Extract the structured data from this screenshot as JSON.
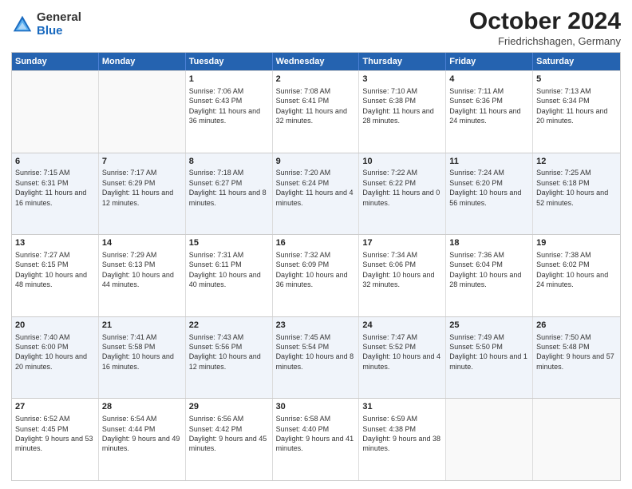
{
  "logo": {
    "general": "General",
    "blue": "Blue"
  },
  "title": "October 2024",
  "subtitle": "Friedrichshagen, Germany",
  "days": [
    "Sunday",
    "Monday",
    "Tuesday",
    "Wednesday",
    "Thursday",
    "Friday",
    "Saturday"
  ],
  "weeks": [
    [
      {
        "day": "",
        "sunrise": "",
        "sunset": "",
        "daylight": ""
      },
      {
        "day": "",
        "sunrise": "",
        "sunset": "",
        "daylight": ""
      },
      {
        "day": "1",
        "sunrise": "Sunrise: 7:06 AM",
        "sunset": "Sunset: 6:43 PM",
        "daylight": "Daylight: 11 hours and 36 minutes."
      },
      {
        "day": "2",
        "sunrise": "Sunrise: 7:08 AM",
        "sunset": "Sunset: 6:41 PM",
        "daylight": "Daylight: 11 hours and 32 minutes."
      },
      {
        "day": "3",
        "sunrise": "Sunrise: 7:10 AM",
        "sunset": "Sunset: 6:38 PM",
        "daylight": "Daylight: 11 hours and 28 minutes."
      },
      {
        "day": "4",
        "sunrise": "Sunrise: 7:11 AM",
        "sunset": "Sunset: 6:36 PM",
        "daylight": "Daylight: 11 hours and 24 minutes."
      },
      {
        "day": "5",
        "sunrise": "Sunrise: 7:13 AM",
        "sunset": "Sunset: 6:34 PM",
        "daylight": "Daylight: 11 hours and 20 minutes."
      }
    ],
    [
      {
        "day": "6",
        "sunrise": "Sunrise: 7:15 AM",
        "sunset": "Sunset: 6:31 PM",
        "daylight": "Daylight: 11 hours and 16 minutes."
      },
      {
        "day": "7",
        "sunrise": "Sunrise: 7:17 AM",
        "sunset": "Sunset: 6:29 PM",
        "daylight": "Daylight: 11 hours and 12 minutes."
      },
      {
        "day": "8",
        "sunrise": "Sunrise: 7:18 AM",
        "sunset": "Sunset: 6:27 PM",
        "daylight": "Daylight: 11 hours and 8 minutes."
      },
      {
        "day": "9",
        "sunrise": "Sunrise: 7:20 AM",
        "sunset": "Sunset: 6:24 PM",
        "daylight": "Daylight: 11 hours and 4 minutes."
      },
      {
        "day": "10",
        "sunrise": "Sunrise: 7:22 AM",
        "sunset": "Sunset: 6:22 PM",
        "daylight": "Daylight: 11 hours and 0 minutes."
      },
      {
        "day": "11",
        "sunrise": "Sunrise: 7:24 AM",
        "sunset": "Sunset: 6:20 PM",
        "daylight": "Daylight: 10 hours and 56 minutes."
      },
      {
        "day": "12",
        "sunrise": "Sunrise: 7:25 AM",
        "sunset": "Sunset: 6:18 PM",
        "daylight": "Daylight: 10 hours and 52 minutes."
      }
    ],
    [
      {
        "day": "13",
        "sunrise": "Sunrise: 7:27 AM",
        "sunset": "Sunset: 6:15 PM",
        "daylight": "Daylight: 10 hours and 48 minutes."
      },
      {
        "day": "14",
        "sunrise": "Sunrise: 7:29 AM",
        "sunset": "Sunset: 6:13 PM",
        "daylight": "Daylight: 10 hours and 44 minutes."
      },
      {
        "day": "15",
        "sunrise": "Sunrise: 7:31 AM",
        "sunset": "Sunset: 6:11 PM",
        "daylight": "Daylight: 10 hours and 40 minutes."
      },
      {
        "day": "16",
        "sunrise": "Sunrise: 7:32 AM",
        "sunset": "Sunset: 6:09 PM",
        "daylight": "Daylight: 10 hours and 36 minutes."
      },
      {
        "day": "17",
        "sunrise": "Sunrise: 7:34 AM",
        "sunset": "Sunset: 6:06 PM",
        "daylight": "Daylight: 10 hours and 32 minutes."
      },
      {
        "day": "18",
        "sunrise": "Sunrise: 7:36 AM",
        "sunset": "Sunset: 6:04 PM",
        "daylight": "Daylight: 10 hours and 28 minutes."
      },
      {
        "day": "19",
        "sunrise": "Sunrise: 7:38 AM",
        "sunset": "Sunset: 6:02 PM",
        "daylight": "Daylight: 10 hours and 24 minutes."
      }
    ],
    [
      {
        "day": "20",
        "sunrise": "Sunrise: 7:40 AM",
        "sunset": "Sunset: 6:00 PM",
        "daylight": "Daylight: 10 hours and 20 minutes."
      },
      {
        "day": "21",
        "sunrise": "Sunrise: 7:41 AM",
        "sunset": "Sunset: 5:58 PM",
        "daylight": "Daylight: 10 hours and 16 minutes."
      },
      {
        "day": "22",
        "sunrise": "Sunrise: 7:43 AM",
        "sunset": "Sunset: 5:56 PM",
        "daylight": "Daylight: 10 hours and 12 minutes."
      },
      {
        "day": "23",
        "sunrise": "Sunrise: 7:45 AM",
        "sunset": "Sunset: 5:54 PM",
        "daylight": "Daylight: 10 hours and 8 minutes."
      },
      {
        "day": "24",
        "sunrise": "Sunrise: 7:47 AM",
        "sunset": "Sunset: 5:52 PM",
        "daylight": "Daylight: 10 hours and 4 minutes."
      },
      {
        "day": "25",
        "sunrise": "Sunrise: 7:49 AM",
        "sunset": "Sunset: 5:50 PM",
        "daylight": "Daylight: 10 hours and 1 minute."
      },
      {
        "day": "26",
        "sunrise": "Sunrise: 7:50 AM",
        "sunset": "Sunset: 5:48 PM",
        "daylight": "Daylight: 9 hours and 57 minutes."
      }
    ],
    [
      {
        "day": "27",
        "sunrise": "Sunrise: 6:52 AM",
        "sunset": "Sunset: 4:45 PM",
        "daylight": "Daylight: 9 hours and 53 minutes."
      },
      {
        "day": "28",
        "sunrise": "Sunrise: 6:54 AM",
        "sunset": "Sunset: 4:44 PM",
        "daylight": "Daylight: 9 hours and 49 minutes."
      },
      {
        "day": "29",
        "sunrise": "Sunrise: 6:56 AM",
        "sunset": "Sunset: 4:42 PM",
        "daylight": "Daylight: 9 hours and 45 minutes."
      },
      {
        "day": "30",
        "sunrise": "Sunrise: 6:58 AM",
        "sunset": "Sunset: 4:40 PM",
        "daylight": "Daylight: 9 hours and 41 minutes."
      },
      {
        "day": "31",
        "sunrise": "Sunrise: 6:59 AM",
        "sunset": "Sunset: 4:38 PM",
        "daylight": "Daylight: 9 hours and 38 minutes."
      },
      {
        "day": "",
        "sunrise": "",
        "sunset": "",
        "daylight": ""
      },
      {
        "day": "",
        "sunrise": "",
        "sunset": "",
        "daylight": ""
      }
    ]
  ]
}
